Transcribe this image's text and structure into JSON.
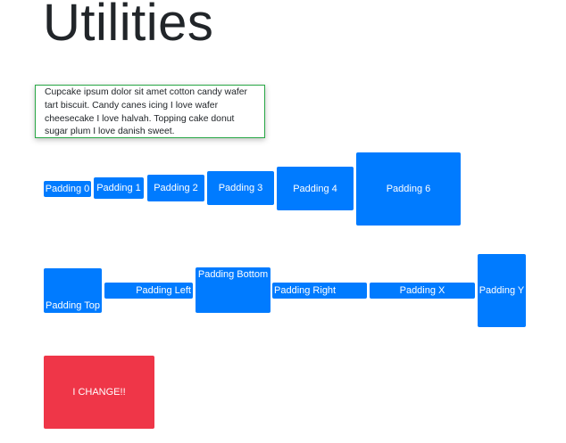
{
  "title": "Utilities",
  "card": {
    "text": "Cupcake ipsum dolor sit amet cotton candy wafer tart biscuit. Candy canes icing I love wafer cheesecake I love halvah. Topping cake donut sugar plum I love danish sweet."
  },
  "padding_buttons": [
    "Padding 0",
    "Padding 1",
    "Padding 2",
    "Padding 3",
    "Padding 4",
    "Padding 6"
  ],
  "direction_buttons": [
    "Padding Top",
    "Padding Left",
    "Padding Bottom",
    "Padding Right",
    "Padding X",
    "Padding Y"
  ],
  "change_box": {
    "label": "I CHANGE!!"
  },
  "colors": {
    "primary": "#007bff",
    "danger": "#ef3648",
    "card_border": "#28a745"
  }
}
